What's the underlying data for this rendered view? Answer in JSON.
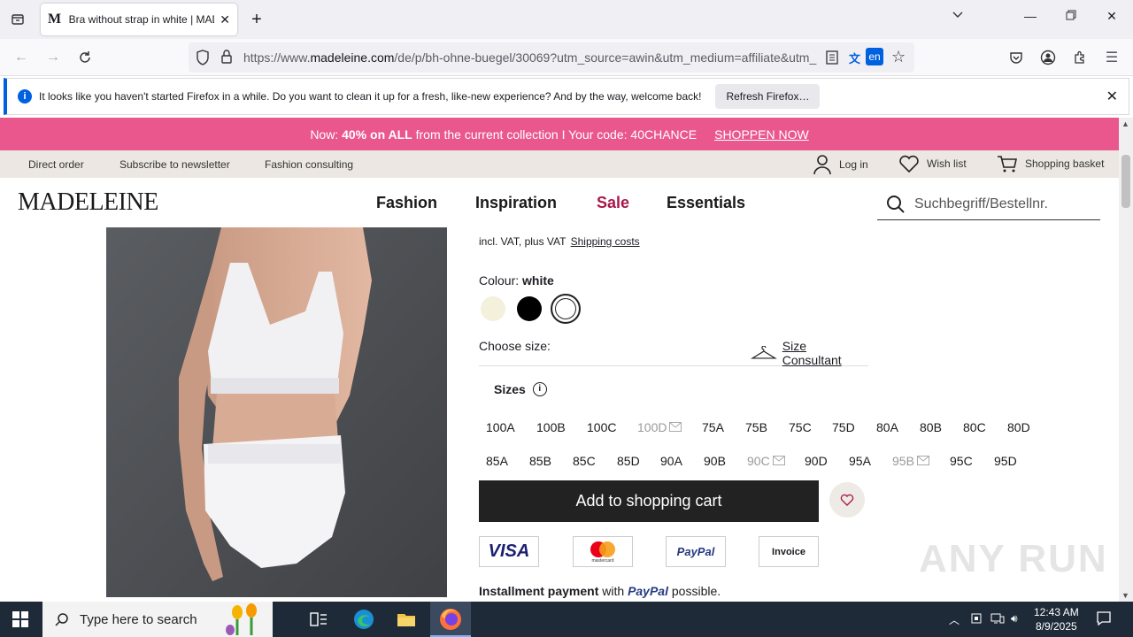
{
  "browser": {
    "tab_title": "Bra without strap in white | MADELEINE",
    "tab_favicon": "M",
    "url_prefix": "https://www.",
    "url_domain": "madeleine.com",
    "url_path": "/de/p/bh-ohne-buegel/30069?utm_source=awin&utm_medium=affiliate&utm_",
    "translate_badge": "en",
    "notification": {
      "message": "It looks like you haven't started Firefox in a while. Do you want to clean it up for a fresh, like-new experience? And by the way, welcome back!",
      "button": "Refresh Firefox…"
    }
  },
  "promo": {
    "prefix": "Now: ",
    "highlight": "40% on ALL",
    "suffix": " from the current collection I Your code: 40CHANCE",
    "link": "SHOPPEN NOW"
  },
  "utility_nav": {
    "direct_order": "Direct order",
    "newsletter": "Subscribe to newsletter",
    "consulting": "Fashion consulting",
    "login": "Log in",
    "wishlist": "Wish list",
    "basket": "Shopping basket"
  },
  "main_nav": {
    "logo": "MADELEINE",
    "items": [
      "Fashion",
      "Inspiration",
      "Sale",
      "Essentials"
    ],
    "search_placeholder": "Suchbegriff/Bestellnr."
  },
  "product": {
    "vat_text": "incl. VAT, plus VAT",
    "shipping_link": "Shipping costs",
    "colour_label": "Colour:",
    "colour_value": "white",
    "swatches": [
      "#f3f0dc",
      "#000000",
      "#ffffff"
    ],
    "choose_size": "Choose size:",
    "size_consultant": "Size Consultant",
    "sizes_title": "Sizes",
    "sizes_row1": [
      {
        "label": "100A",
        "available": true
      },
      {
        "label": "100B",
        "available": true
      },
      {
        "label": "100C",
        "available": true
      },
      {
        "label": "100D",
        "available": false
      },
      {
        "label": "75A",
        "available": true
      },
      {
        "label": "75B",
        "available": true
      },
      {
        "label": "75C",
        "available": true
      },
      {
        "label": "75D",
        "available": true
      },
      {
        "label": "80A",
        "available": true
      },
      {
        "label": "80B",
        "available": true
      },
      {
        "label": "80C",
        "available": true
      },
      {
        "label": "80D",
        "available": true
      }
    ],
    "sizes_row2": [
      {
        "label": "85A",
        "available": true
      },
      {
        "label": "85B",
        "available": true
      },
      {
        "label": "85C",
        "available": true
      },
      {
        "label": "85D",
        "available": true
      },
      {
        "label": "90A",
        "available": true
      },
      {
        "label": "90B",
        "available": true
      },
      {
        "label": "90C",
        "available": false
      },
      {
        "label": "90D",
        "available": true
      },
      {
        "label": "95A",
        "available": true
      },
      {
        "label": "95B",
        "available": false
      },
      {
        "label": "95C",
        "available": true
      },
      {
        "label": "95D",
        "available": true
      }
    ],
    "add_to_cart": "Add to shopping cart",
    "payments": [
      "VISA",
      "mastercard",
      "PayPal",
      "Invoice"
    ],
    "installment_bold": "Installment payment",
    "installment_with": "with",
    "installment_paypal": "PayPal",
    "installment_end": "possible."
  },
  "watermark": "ANY RUN",
  "taskbar": {
    "search_placeholder": "Type here to search",
    "time": "12:43 AM",
    "date": "8/9/2025"
  },
  "colors": {
    "promo_bg": "#e9578d",
    "sale": "#a8174a",
    "utility_bg": "#ece7e2",
    "cart_btn": "#222222"
  }
}
